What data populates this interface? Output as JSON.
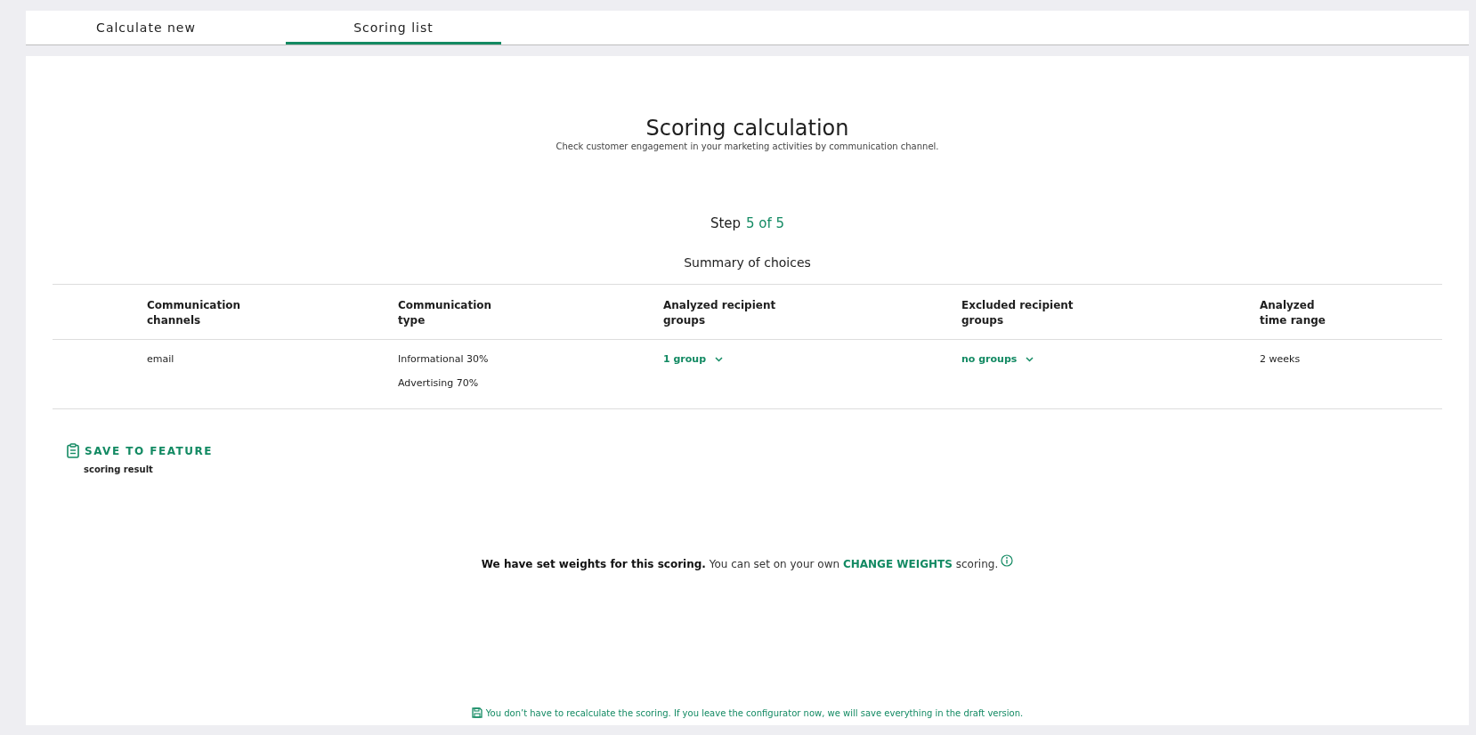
{
  "tabs": [
    {
      "label": "Calculate new",
      "selected": false
    },
    {
      "label": "Scoring list",
      "selected": true
    }
  ],
  "header": {
    "title": "Scoring calculation",
    "subtitle": "Check customer engagement in your marketing activities by communication channel."
  },
  "step": {
    "label": "Step",
    "progress": "5 of 5",
    "progress_highlighted": true
  },
  "summary": {
    "title": "Summary of choices",
    "columns": [
      {
        "line1": "Communication",
        "line2": "channels"
      },
      {
        "line1": "Communication",
        "line2": "type"
      },
      {
        "line1": "Analyzed recipient",
        "line2": "groups"
      },
      {
        "line1": "Excluded recipient",
        "line2": "groups"
      },
      {
        "line1": "Analyzed",
        "line2": "time range"
      }
    ],
    "row": [
      {
        "kind": "text",
        "lines": [
          "email"
        ]
      },
      {
        "kind": "text",
        "lines": [
          "Informational 30%",
          "Advertising 70%"
        ]
      },
      {
        "kind": "dropdown",
        "label": "1 group"
      },
      {
        "kind": "dropdown",
        "label": "no groups"
      },
      {
        "kind": "text",
        "lines": [
          "2 weeks"
        ]
      }
    ]
  },
  "save": {
    "button": "SAVE TO FEATURE",
    "caption": "scoring result"
  },
  "weights": {
    "sentence": "**We have set weights for this scoring.** You can set on your own",
    "link": "CHANGE WEIGHTS",
    "tail": "scoring."
  },
  "footer": "You don’t have to recalculate the scoring. If you leave the configurator now, we will save everything in the draft version."
}
